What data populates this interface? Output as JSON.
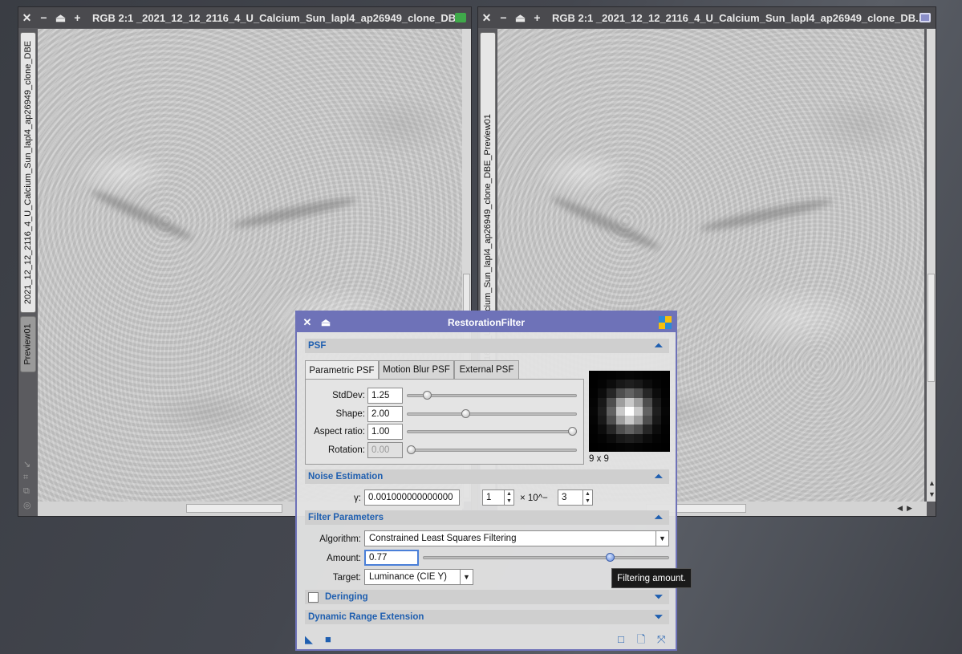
{
  "left_window": {
    "title": "RGB 2:1 _2021_12_12_2116_4_U_Calcium_Sun_lapl4_ap26949_clone_DB...",
    "active_view_tab": "2021_12_12_2116_4_U_Calcium_Sun_lapl4_ap26949_clone_DBE",
    "preview_tab": "Preview01"
  },
  "right_window": {
    "title": "RGB 2:1 _2021_12_12_2116_4_U_Calcium_Sun_lapl4_ap26949_clone_DB...",
    "active_view_tab": "2021_12_12_2116_4_U_Calcium_Sun_lapl4_ap26949_clone_DBE_Preview01"
  },
  "dialog": {
    "title": "RestorationFilter",
    "psf": {
      "section_label": "PSF",
      "tabs": [
        "Parametric PSF",
        "Motion Blur PSF",
        "External PSF"
      ],
      "active_tab": "Parametric PSF",
      "stddev_label": "StdDev:",
      "stddev_value": "1.25",
      "stddev_slider": 0.1,
      "shape_label": "Shape:",
      "shape_value": "2.00",
      "shape_slider": 0.34,
      "aspect_label": "Aspect ratio:",
      "aspect_value": "1.00",
      "aspect_slider": 1.0,
      "rotation_label": "Rotation:",
      "rotation_value": "0.00",
      "rotation_slider": 0.0,
      "preview_size": "9 x 9"
    },
    "noise": {
      "section_label": "Noise Estimation",
      "gamma_label": "γ:",
      "gamma_value": "0.001000000000000",
      "mantissa": "1",
      "times_label": "× 10^−",
      "exponent": "3"
    },
    "filter": {
      "section_label": "Filter Parameters",
      "algorithm_label": "Algorithm:",
      "algorithm_value": "Constrained Least Squares Filtering",
      "amount_label": "Amount:",
      "amount_value": "0.77",
      "amount_slider": 0.77,
      "target_label": "Target:",
      "target_value": "Luminance (CIE Y)"
    },
    "deringing_label": "Deringing",
    "deringing_checked": false,
    "dynamic_range_label": "Dynamic Range Extension"
  },
  "tooltip": "Filtering amount.",
  "colors": {
    "dialog_title": "#6e72b8",
    "section_text": "#1f5fb0"
  }
}
